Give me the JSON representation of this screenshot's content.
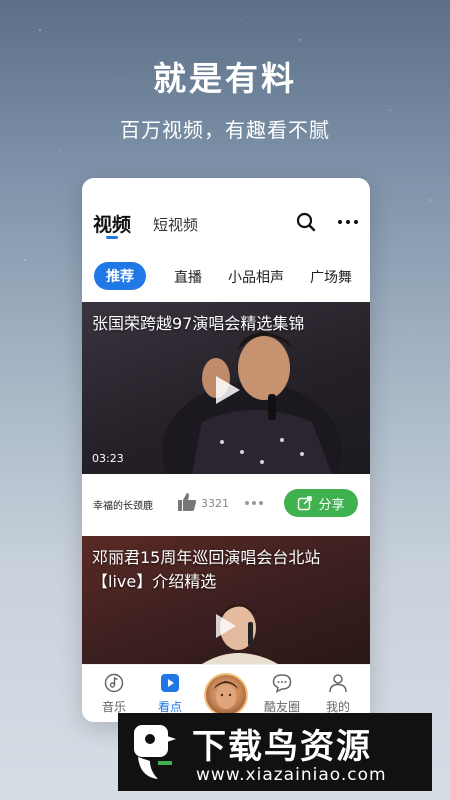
{
  "promo": {
    "headline": "就是有料",
    "subline": "百万视频，有趣看不腻"
  },
  "app": {
    "tabs": {
      "main": "视频",
      "short": "短视频"
    },
    "icons": {
      "search": "search-icon",
      "more": "more-icon"
    },
    "categories": {
      "active": "推荐",
      "items": [
        "直播",
        "小品相声",
        "广场舞"
      ]
    },
    "videos": [
      {
        "title": "张国荣跨越97演唱会精选集锦",
        "duration": "03:23",
        "author": "幸福的长颈鹿",
        "likes": "3321",
        "share_label": "分享"
      },
      {
        "title": "邓丽君15周年巡回演唱会台北站【live】介绍精选"
      }
    ],
    "bottom_nav": {
      "items": [
        {
          "label": "音乐",
          "icon": "music-disc-icon",
          "active": false
        },
        {
          "label": "看点",
          "icon": "play-square-icon",
          "active": true
        },
        {
          "label": "酷友圈",
          "icon": "chat-bubble-icon",
          "active": false
        },
        {
          "label": "我的",
          "icon": "person-icon",
          "active": false
        }
      ]
    },
    "colors": {
      "accent": "#1f78e6",
      "share": "#3fb24f"
    }
  },
  "watermark": {
    "title": "下载鸟资源",
    "url": "www.xiazainiao.com"
  }
}
